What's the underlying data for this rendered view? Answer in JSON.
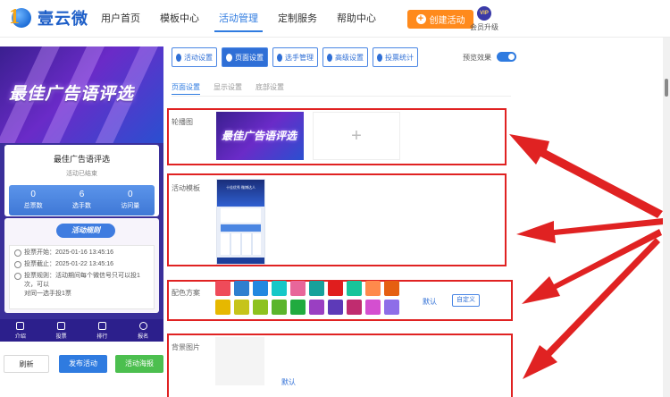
{
  "logo": {
    "text": "壹云微"
  },
  "nav": [
    {
      "label": "用户首页",
      "active": false
    },
    {
      "label": "模板中心",
      "active": false
    },
    {
      "label": "活动管理",
      "active": true
    },
    {
      "label": "定制服务",
      "active": false
    },
    {
      "label": "帮助中心",
      "active": false
    }
  ],
  "header": {
    "create_label": "创建活动",
    "vip_badge": "VIP",
    "vip_label": "会员升级"
  },
  "preview": {
    "banner_title": "最佳广告语评选",
    "title": "最佳广告语评选",
    "status": "活动已结束",
    "stats": [
      {
        "value": "0",
        "label": "总票数"
      },
      {
        "value": "6",
        "label": "选手数"
      },
      {
        "value": "0",
        "label": "访问量"
      }
    ],
    "rules_label": "活动规则",
    "start": "投票开始：2025-01-16 13:45:16",
    "end": "投票截止：2025-01-22 13:45:16",
    "rule_line1": "投票规则：活动期间每个微信号只可以投1次，可以",
    "rule_line2": "对同一选手投1票",
    "tabs": [
      "介绍",
      "投票",
      "排行",
      "报名"
    ]
  },
  "actions": {
    "refresh": "刷新",
    "publish": "发布活动",
    "poster": "活动海报"
  },
  "toolbar": [
    "活动设置",
    "页面设置",
    "选手管理",
    "高级设置",
    "投票统计"
  ],
  "toolbar_active": "页面设置",
  "effect_label": "预览效果",
  "subtabs": [
    "页面设置",
    "显示设置",
    "底部设置"
  ],
  "sections": {
    "carousel": {
      "label": "轮播图",
      "image_text": "最佳广告语评选",
      "add": "+"
    },
    "template": {
      "label": "活动模板",
      "thumb_text": "十佳优秀 微博达人"
    },
    "colors": {
      "label": "配色方案",
      "default": "默认",
      "custom": "自定义"
    },
    "background": {
      "label": "背景图片",
      "default": "默认"
    }
  },
  "palette": [
    "#ef4b5a",
    "#2f7fcf",
    "#2288e0",
    "#15c8c8",
    "#e8669a",
    "#17a19b",
    "#e01e1e",
    "#18c49a",
    "#ff8a4c",
    "#e55f12",
    "#e6b800",
    "#c6c41a",
    "#8dc21f",
    "#5bb52c",
    "#21ab3f",
    "#9a3fc2",
    "#5d3ab8",
    "#c02c6f",
    "#d44fd0",
    "#8e6ee8"
  ],
  "colors": {
    "accent": "#2f7be0",
    "create": "#ff8a1c",
    "annotation": "#e02222",
    "publish": "#2f7be0",
    "poster": "#4cbf4f"
  }
}
